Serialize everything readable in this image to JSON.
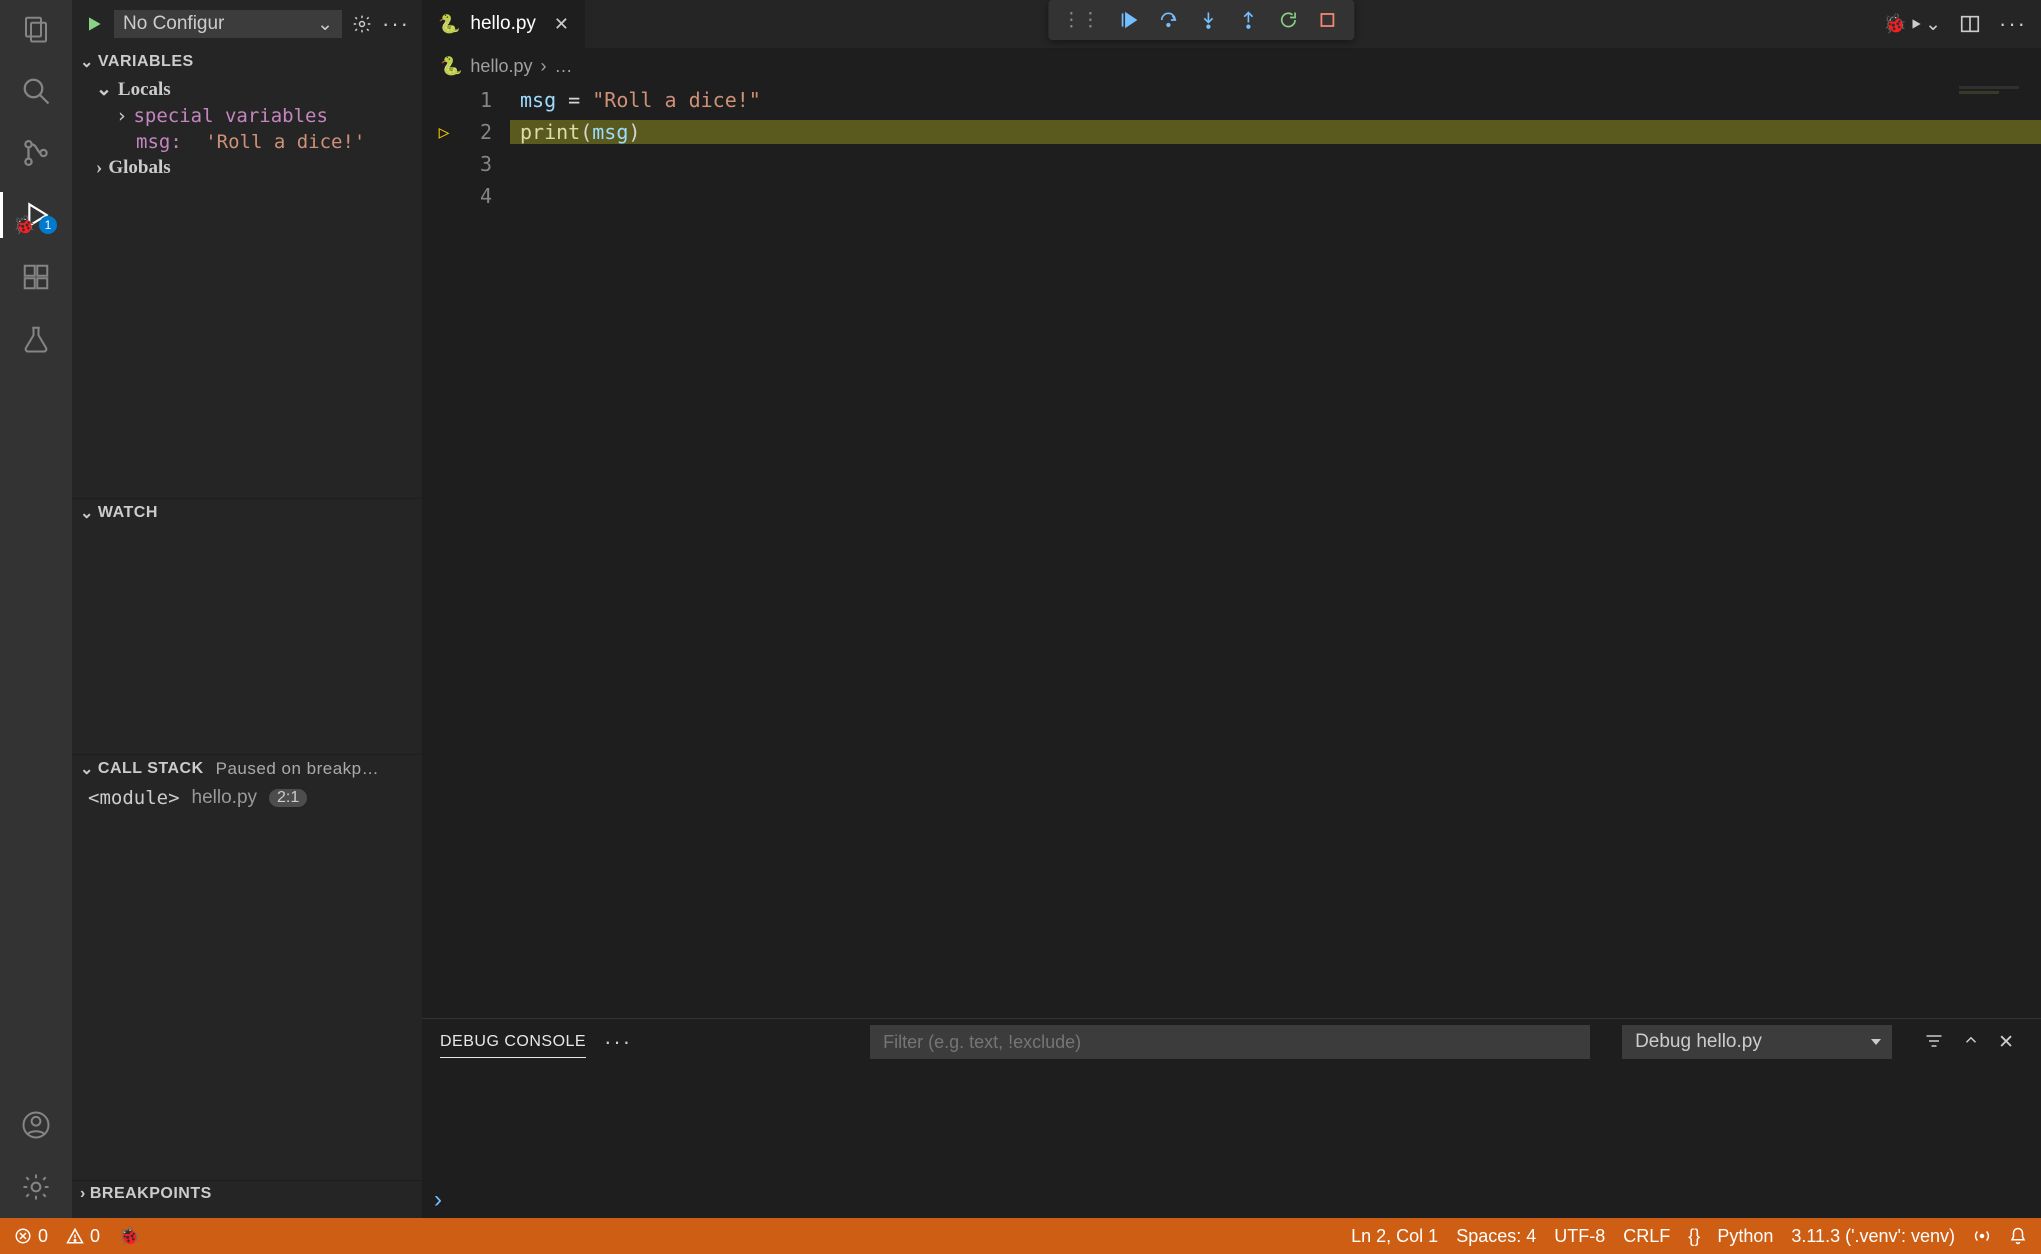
{
  "activity": {
    "debug_badge": "1"
  },
  "sidebar": {
    "config_label": "No Configur",
    "sections": {
      "variables": {
        "title": "VARIABLES",
        "locals_label": "Locals",
        "special_label": "special variables",
        "msg_key": "msg:",
        "msg_val": "'Roll a dice!'",
        "globals_label": "Globals"
      },
      "watch": {
        "title": "WATCH"
      },
      "callstack": {
        "title": "CALL STACK",
        "status": "Paused on breakp…",
        "frame_name": "<module>",
        "frame_file": "hello.py",
        "frame_pos": "2:1"
      },
      "breakpoints": {
        "title": "BREAKPOINTS"
      }
    }
  },
  "tabs": {
    "file": "hello.py"
  },
  "breadcrumb": {
    "file": "hello.py",
    "rest": "…"
  },
  "code": {
    "lines": [
      "1",
      "2",
      "3",
      "4"
    ],
    "l1_var": "msg",
    "l1_op": " = ",
    "l1_str": "\"Roll a dice!\"",
    "l2_fn": "print",
    "l2_open": "(",
    "l2_arg": "msg",
    "l2_close": ")"
  },
  "panel": {
    "tab": "DEBUG CONSOLE",
    "filter_placeholder": "Filter (e.g. text, !exclude)",
    "session": "Debug hello.py"
  },
  "statusbar": {
    "errors": "0",
    "warnings": "0",
    "ln_col": "Ln 2, Col 1",
    "spaces": "Spaces: 4",
    "encoding": "UTF-8",
    "eol": "CRLF",
    "lang_icon": "{}",
    "lang": "Python",
    "interp": "3.11.3 ('.venv': venv)"
  }
}
